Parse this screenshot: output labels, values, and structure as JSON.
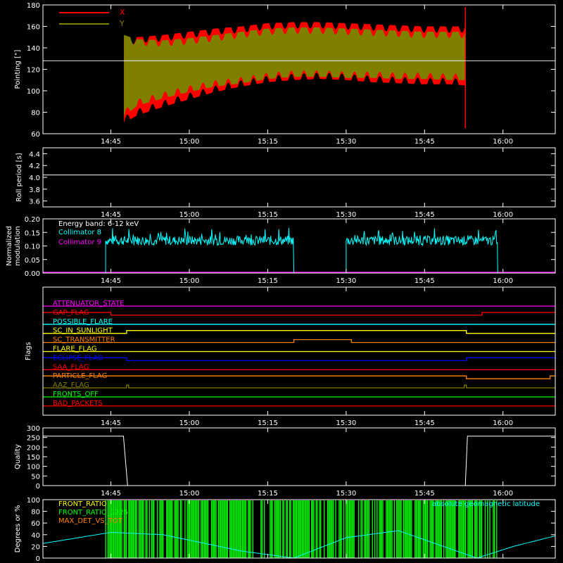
{
  "time_axis": {
    "range": [
      "14:32",
      "16:10"
    ],
    "tick_labels": [
      "14:45",
      "15:00",
      "15:15",
      "15:30",
      "15:45",
      "16:00"
    ],
    "tick_values_min": [
      45,
      60,
      75,
      90,
      105,
      120
    ]
  },
  "colors": {
    "X": "#ff0000",
    "Y": "#808000",
    "white": "#ffffff",
    "cyan": "#00ffff",
    "magenta": "#ff00ff",
    "green": "#00ff00",
    "orange": "#ff8000",
    "yellow": "#ffff00",
    "blue": "#0000ff",
    "red": "#ff0000"
  },
  "chart_data": [
    {
      "id": "pointing",
      "type": "area",
      "ylabel": "Pointing [\"]",
      "ylim": [
        60,
        180
      ],
      "yticks": [
        "60",
        "80",
        "100",
        "120",
        "140",
        "160",
        "180"
      ],
      "legend": [
        "X",
        "Y"
      ],
      "reference_line_y": 128,
      "series": [
        {
          "name": "X",
          "x_min": [
            47.5,
            50,
            55,
            60,
            65,
            70,
            75,
            80,
            85,
            90,
            95,
            100,
            105,
            110,
            112.8
          ],
          "upper": [
            148,
            150,
            152,
            155,
            158,
            160,
            163,
            164,
            164,
            163,
            162,
            161,
            160,
            160,
            160
          ],
          "lower": [
            70,
            77,
            85,
            92,
            99,
            104,
            108,
            110,
            111,
            110,
            108,
            107,
            106,
            106,
            105
          ]
        },
        {
          "name": "Y",
          "x_min": [
            47.5,
            50,
            55,
            60,
            65,
            70,
            75,
            80,
            85,
            90,
            95,
            100,
            105,
            110,
            112.8
          ],
          "upper": [
            152,
            148,
            147,
            149,
            152,
            155,
            158,
            159,
            159,
            158,
            157,
            156,
            155,
            155,
            155
          ],
          "lower": [
            76,
            86,
            93,
            99,
            104,
            107,
            111,
            113,
            113,
            112,
            112,
            111,
            111,
            110,
            110
          ]
        }
      ]
    },
    {
      "id": "roll",
      "type": "line",
      "ylabel": "Roll period [s]",
      "ylim": [
        3.5,
        4.5
      ],
      "yticks": [
        "3.6",
        "3.8",
        "4.0",
        "4.2",
        "4.4"
      ],
      "series": [
        {
          "x_min": [
            32,
            130
          ],
          "y": [
            4.04,
            4.04
          ]
        }
      ]
    },
    {
      "id": "modulation",
      "type": "line",
      "ylabel": [
        "Normalized",
        "modulation"
      ],
      "ylim": [
        0,
        0.2
      ],
      "yticks": [
        "0.00",
        "0.05",
        "0.10",
        "0.15",
        "0.20"
      ],
      "annotation": "Energy band: 6-12 keV",
      "legend": [
        "Collimator 8",
        "Collimator 9"
      ],
      "series": [
        {
          "name": "Collimator 8",
          "segments": [
            [
              44,
              80,
              0.12
            ],
            [
              90,
              119,
              0.12
            ]
          ]
        },
        {
          "name": "Collimator 9",
          "x_min": [
            32,
            130
          ],
          "y": [
            0,
            0
          ]
        }
      ]
    },
    {
      "id": "flags",
      "type": "line",
      "ylabel": "Flags",
      "series": [
        {
          "name": "ATTENUATOR_STATE",
          "color": "#ff00ff",
          "steps": [
            [
              32,
              0
            ]
          ]
        },
        {
          "name": "GAP_FLAG",
          "color": "#ff0000",
          "steps": [
            [
              32,
              1
            ],
            [
              45,
              0
            ],
            [
              116,
              1
            ]
          ]
        },
        {
          "name": "POSSIBLE_FLARE",
          "color": "#00ffff",
          "steps": [
            [
              32,
              0
            ]
          ]
        },
        {
          "name": "SC_IN_SUNLIGHT",
          "color": "#ffff00",
          "steps": [
            [
              32,
              0
            ],
            [
              48,
              1
            ],
            [
              113,
              0
            ]
          ]
        },
        {
          "name": "SC_TRANSMITTER",
          "color": "#ff8000",
          "steps": [
            [
              32,
              0
            ],
            [
              80,
              1
            ],
            [
              91,
              0
            ]
          ]
        },
        {
          "name": "FLARE_FLAG",
          "color": "#ffff00",
          "steps": [
            [
              32,
              0
            ]
          ]
        },
        {
          "name": "ECLIPSE_FLAG",
          "color": "#0000ff",
          "steps": [
            [
              32,
              1
            ],
            [
              48,
              0
            ],
            [
              113,
              1
            ]
          ]
        },
        {
          "name": "SAA_FLAG",
          "color": "#ff0000",
          "steps": [
            [
              32,
              0
            ]
          ]
        },
        {
          "name": "PARTICLE_FLAG",
          "color": "#ff8000",
          "steps": [
            [
              32,
              1
            ],
            [
              113,
              0
            ],
            [
              129,
              1
            ]
          ]
        },
        {
          "name": "AAZ_FLAG",
          "color": "#808000",
          "steps": [
            [
              32,
              0
            ],
            [
              48,
              1
            ],
            [
              48.4,
              0
            ],
            [
              112.6,
              1
            ],
            [
              113,
              0
            ]
          ]
        },
        {
          "name": "FRONTS_OFF",
          "color": "#00ff00",
          "steps": [
            [
              32,
              0
            ]
          ]
        },
        {
          "name": "BAD_PACKETS",
          "color": "#ff0000",
          "steps": [
            [
              32,
              0
            ]
          ]
        }
      ]
    },
    {
      "id": "quality",
      "type": "line",
      "ylabel": "Quality",
      "ylim": [
        0,
        300
      ],
      "yticks": [
        "0",
        "50",
        "100",
        "150",
        "200",
        "250",
        "300"
      ],
      "series": [
        {
          "x_min": [
            32,
            47.4,
            48.2,
            112.8,
            113.2,
            130
          ],
          "y": [
            257,
            257,
            0,
            0,
            257,
            257
          ]
        }
      ]
    },
    {
      "id": "ratios",
      "type": "line",
      "ylabel": "Degrees or %",
      "ylim": [
        0,
        100
      ],
      "yticks": [
        "0",
        "20",
        "40",
        "60",
        "80",
        "100"
      ],
      "legend": [
        "FRONT_RATIO",
        "FRONT_RATIO_1225",
        "MAX_DET_VS_TOT"
      ],
      "right_label": "absolute geomagnetic latitude",
      "series": [
        {
          "name": "absolute geomagnetic latitude",
          "x_min": [
            32,
            45,
            55,
            70,
            80,
            90,
            100,
            115,
            122,
            130
          ],
          "y": [
            25,
            44,
            40,
            12,
            0,
            35,
            47,
            0,
            20,
            38
          ]
        },
        {
          "name": "FRONT_RATIO",
          "range": [
            44,
            119
          ]
        }
      ]
    }
  ]
}
